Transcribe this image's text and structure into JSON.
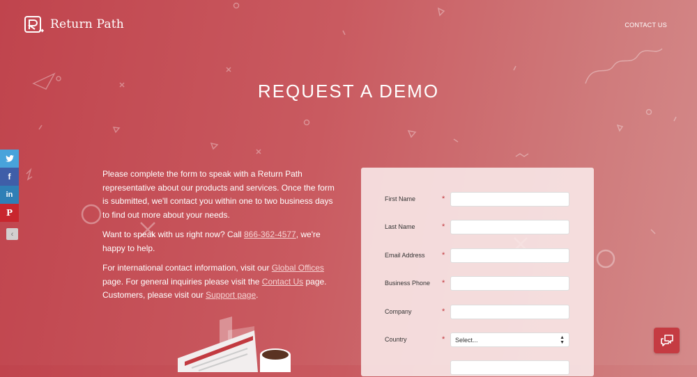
{
  "header": {
    "logo_text": "Return Path",
    "contact_link": "CONTACT US"
  },
  "page": {
    "title": "REQUEST A DEMO"
  },
  "intro": {
    "p1": "Please complete the form to speak with a Return Path representative about our products and services. Once the form is submitted, we'll contact you within one to two business days to find out more about your needs.",
    "p2_before": "Want to speak with us right now? Call ",
    "phone": "866-362-4577",
    "p2_after": ", we're happy to help.",
    "p3_a": "For international contact information, visit our ",
    "global_offices": "Global Offices",
    "p3_b": " page. For general inquiries please visit the ",
    "contact_us": "Contact Us",
    "p3_c": " page. Customers, please visit our ",
    "support_page": "Support page",
    "p3_d": "."
  },
  "form": {
    "required_mark": "*",
    "fields": [
      {
        "label": "First Name",
        "value": ""
      },
      {
        "label": "Last Name",
        "value": ""
      },
      {
        "label": "Email Address",
        "value": ""
      },
      {
        "label": "Business Phone",
        "value": ""
      },
      {
        "label": "Company",
        "value": ""
      },
      {
        "label": "Country",
        "selected": "Select..."
      }
    ]
  },
  "social": {
    "items": [
      "twitter-icon",
      "facebook-icon",
      "linkedin-icon",
      "pinterest-icon"
    ]
  },
  "colors": {
    "accent": "#c0353a",
    "twitter": "#48a3db",
    "facebook": "#3f5ea8",
    "linkedin": "#2f7fb6",
    "pinterest": "#c8262e"
  }
}
